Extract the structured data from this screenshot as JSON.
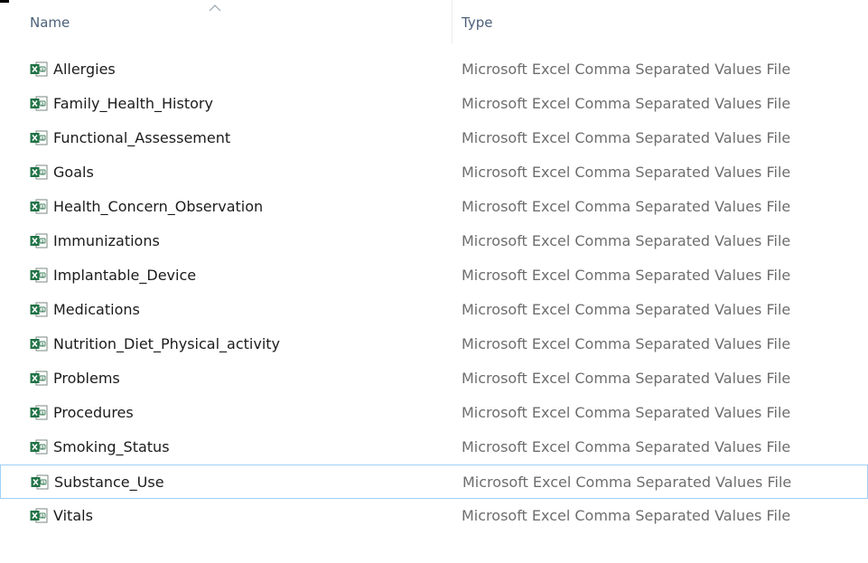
{
  "header": {
    "name_label": "Name",
    "type_label": "Type",
    "sort_icon": "chevron-up-icon"
  },
  "file_icon": "excel-csv-icon",
  "files": [
    {
      "name": "Allergies",
      "type": "Microsoft Excel Comma Separated Values File"
    },
    {
      "name": "Family_Health_History",
      "type": "Microsoft Excel Comma Separated Values File"
    },
    {
      "name": "Functional_Assessement",
      "type": "Microsoft Excel Comma Separated Values File"
    },
    {
      "name": "Goals",
      "type": "Microsoft Excel Comma Separated Values File"
    },
    {
      "name": "Health_Concern_Observation",
      "type": "Microsoft Excel Comma Separated Values File"
    },
    {
      "name": "Immunizations",
      "type": "Microsoft Excel Comma Separated Values File"
    },
    {
      "name": "Implantable_Device",
      "type": "Microsoft Excel Comma Separated Values File"
    },
    {
      "name": "Medications",
      "type": "Microsoft Excel Comma Separated Values File"
    },
    {
      "name": "Nutrition_Diet_Physical_activity",
      "type": "Microsoft Excel Comma Separated Values File"
    },
    {
      "name": "Problems",
      "type": "Microsoft Excel Comma Separated Values File"
    },
    {
      "name": "Procedures",
      "type": "Microsoft Excel Comma Separated Values File"
    },
    {
      "name": "Smoking_Status",
      "type": "Microsoft Excel Comma Separated Values File"
    },
    {
      "name": "Substance_Use",
      "type": "Microsoft Excel Comma Separated Values File",
      "hovered": true
    },
    {
      "name": "Vitals",
      "type": "Microsoft Excel Comma Separated Values File"
    }
  ],
  "colors": {
    "header_text": "#4c607a",
    "name_text": "#1b1b1b",
    "type_text": "#6d6d6d",
    "hover_border": "#9fd0f6",
    "excel_green": "#217346"
  }
}
